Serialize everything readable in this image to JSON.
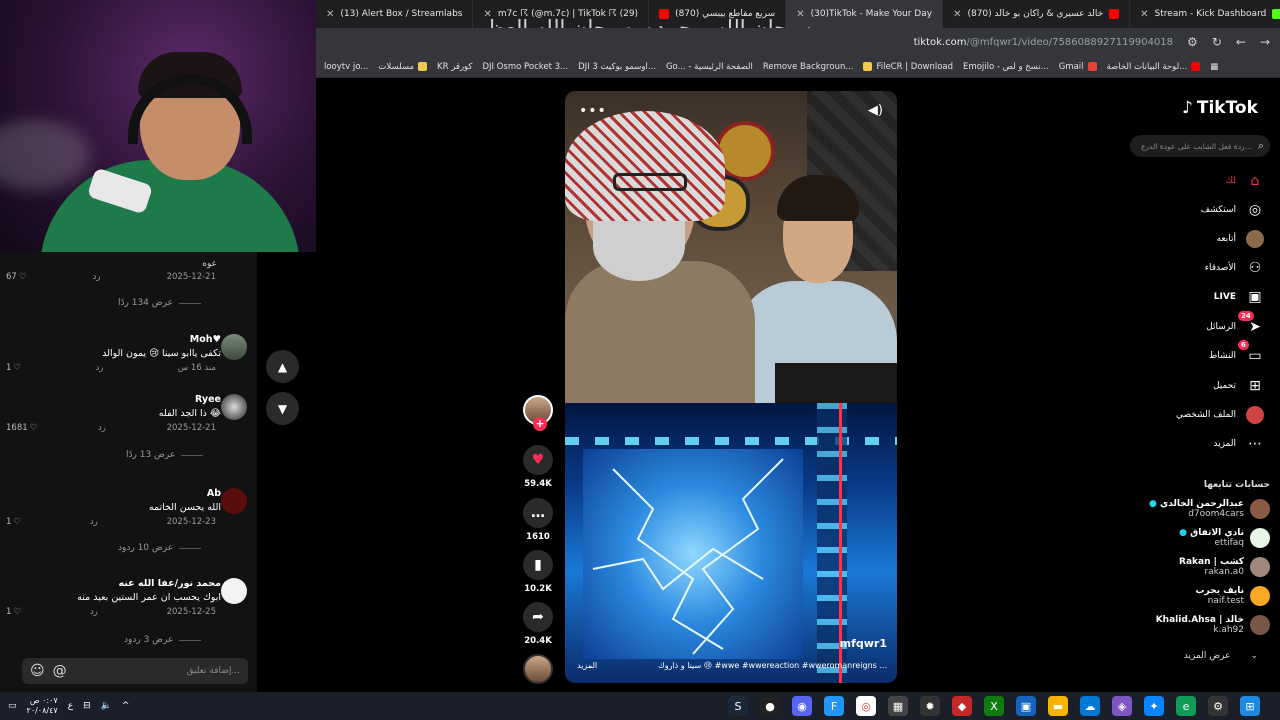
{
  "overlay": {
    "title_text": "سبحان الله وبحمده، سبحان الله العظيم"
  },
  "browser": {
    "tabs": [
      {
        "label": "(13) Alert Box / Streamlabs",
        "color": "#7fd3a8"
      },
      {
        "label": "m7c ☈ (@m.7c) | TikTok ☈ (29)",
        "color": "#2d2d30"
      },
      {
        "label": "(870) سريع مقاطع بيبسي",
        "color": "#ff0000"
      },
      {
        "label": "(30)TikTok - Make Your Day",
        "color": "#111111",
        "active": true
      },
      {
        "label": "(870) خالد عسيري & راكان بو خالد",
        "color": "#ff0000"
      },
      {
        "label": "Stream - Kick Dashboard",
        "color": "#53fc18"
      }
    ],
    "url_host": "tiktok.com",
    "url_path": "/@mfqwr1/video/7586088927119904018",
    "bookmarks": [
      {
        "label": "looytv jo...",
        "color": "#555555"
      },
      {
        "label": "مسلسلات",
        "color": "#f2c94c"
      },
      {
        "label": "KR كورقر",
        "color": "#333333"
      },
      {
        "label": "DJI Osmo Pocket 3...",
        "color": "#333333"
      },
      {
        "label": "DJI اوسمو بوكيت 3...",
        "color": "#333333"
      },
      {
        "label": "Go... - الصفحة الرئيسية",
        "color": "#4285f4"
      },
      {
        "label": "Remove Backgroun...",
        "color": "#333333"
      },
      {
        "label": "FileCR | Download",
        "color": "#f2c94c"
      },
      {
        "label": "Emojilo - نسخ و لص...",
        "color": "#f2c94c"
      },
      {
        "label": "Gmail",
        "color": "#ea4335"
      },
      {
        "label": "لوحة البيانات الخاصة...",
        "color": "#ff0000"
      }
    ]
  },
  "comments": {
    "top_fragment": "عوه",
    "items": [
      {
        "meta_date": "2025-12-21",
        "reply": "رد",
        "likes": "67",
        "replies_label": "عرض 134 ردًا"
      },
      {
        "name": "Moh♥",
        "text": "تكفى ياابو سينا 😢 يمون الوالد",
        "meta_date": "منذ 16 س",
        "reply": "رد",
        "likes": "1"
      },
      {
        "name": "Ryee",
        "text": "ذا الجد الفله 😂",
        "meta_date": "2025-12-21",
        "reply": "رد",
        "likes": "1681",
        "replies_label": "عرض 13 ردًا"
      },
      {
        "name": "Ab",
        "text": "الله يحسن الخاتمه",
        "meta_date": "2025-12-23",
        "reply": "رد",
        "likes": "1",
        "replies_label": "عرض 10 ردود"
      },
      {
        "name": "محمد نور/عفا الله عنه",
        "text": "ابوك يحسب ان عمر الستين بعيد منه",
        "meta_date": "2025-12-25",
        "reply": "رد",
        "likes": "1",
        "replies_label": "عرض 3 ردود"
      }
    ],
    "input_placeholder": "إضافة تعليق..."
  },
  "video": {
    "watermark": "mfqwr1",
    "caption": "سينا و ذاروك 😢 #wwe #wwereaction #wweromanreigns ...",
    "more_label": "المزيد"
  },
  "actions": {
    "likes": "59.4K",
    "comments": "1610",
    "saves": "10.2K",
    "shares": "20.4K"
  },
  "sidebar": {
    "logo": "TikTok",
    "search_placeholder": "ردة فعل الشايب على عودة الدرع...",
    "nav": [
      {
        "label": "لك",
        "icon": "home-icon",
        "active": true
      },
      {
        "label": "استكشف",
        "icon": "compass-icon"
      },
      {
        "label": "أتابعه",
        "icon": "following-avatar-icon"
      },
      {
        "label": "الأصدقاء",
        "icon": "friends-icon"
      },
      {
        "label": "LIVE",
        "icon": "live-icon"
      },
      {
        "label": "الرسائل",
        "icon": "messages-icon",
        "badge": "24"
      },
      {
        "label": "النشاط",
        "icon": "activity-icon",
        "badge": "6"
      },
      {
        "label": "تحميل",
        "icon": "upload-icon"
      },
      {
        "label": "الملف الشخصي",
        "icon": "profile-icon"
      },
      {
        "label": "المزيد",
        "icon": "more-icon"
      }
    ],
    "following_title": "حسابات تتابعها",
    "following": [
      {
        "name": "عبدالرحمن الخالدي",
        "user": "d7oom4cars",
        "verified": true,
        "color": "#8a5a44"
      },
      {
        "name": "نادي الاتفاق",
        "user": "ettifaq",
        "verified": true,
        "color": "#2e7d32"
      },
      {
        "name": "Rakan | كشب",
        "user": "rakan.a0",
        "verified": false,
        "color": "#a1887f"
      },
      {
        "name": "نايف يجرب",
        "user": "naif.test",
        "verified": false,
        "color": "#f9a825"
      },
      {
        "name": "Khalid.Ahsa | خالد",
        "user": "k.ah92",
        "verified": false,
        "color": "#795548"
      }
    ],
    "see_more": "عرض المزيد"
  },
  "taskbar": {
    "time": "٠:٠٧ ص",
    "date": "٢٠/٠٨/٤٧",
    "lang": "ع"
  }
}
